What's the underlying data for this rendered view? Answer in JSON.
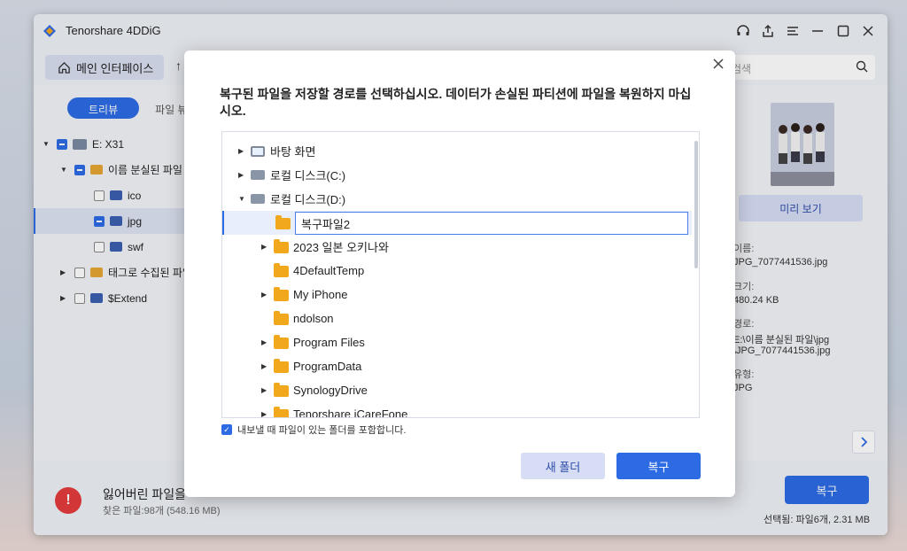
{
  "app": {
    "title": "Tenorshare 4DDiG",
    "home_label": "메인 인터페이스",
    "search_placeholder": "검색"
  },
  "tabs": {
    "tree": "트리뷰",
    "file": "파일 뷰"
  },
  "tree": {
    "items": [
      {
        "label": "E: X31"
      },
      {
        "label": "이름 분실된 파일"
      },
      {
        "label": "ico"
      },
      {
        "label": "jpg"
      },
      {
        "label": "swf"
      },
      {
        "label": "태그로 수집된 파일"
      },
      {
        "label": "$Extend"
      }
    ]
  },
  "right_panel": {
    "preview_label": "미리 보기",
    "name_label": "이름:",
    "name_value": "JPG_7077441536.jpg",
    "size_label": "크기:",
    "size_value": "480.24 KB",
    "path_label": "경로:",
    "path_value1": "E:\\이름 분실된 파일\\jpg",
    "path_value2": "\\JPG_7077441536.jpg",
    "type_label": "유형:",
    "type_value": "JPG"
  },
  "footer": {
    "title": "잃어버린 파일을",
    "sub": "찾은 파일:98개 (548.16 MB)",
    "recover_label": "복구",
    "selected": "선택됨: 파일6개, 2.31 MB"
  },
  "dialog": {
    "title": "복구된 파일을 저장할 경로를 선택하십시오. 데이터가 손실된 파티션에 파일을 복원하지 마십시오.",
    "nodes": [
      {
        "label": "바탕 화면"
      },
      {
        "label": "로컬 디스크(C:)"
      },
      {
        "label": "로컬 디스크(D:)"
      },
      {
        "label": "복구파일2"
      },
      {
        "label": "2023 일본 오키나와"
      },
      {
        "label": "4DefaultTemp"
      },
      {
        "label": "My iPhone"
      },
      {
        "label": "ndolson"
      },
      {
        "label": "Program Files"
      },
      {
        "label": "ProgramData"
      },
      {
        "label": "SynologyDrive"
      },
      {
        "label": "Tenorshare iCareFone"
      }
    ],
    "include_label": "내보낼 때 파일이 있는 폴더를 포함합니다.",
    "new_folder_label": "새 폴더",
    "recover_label": "복구"
  }
}
